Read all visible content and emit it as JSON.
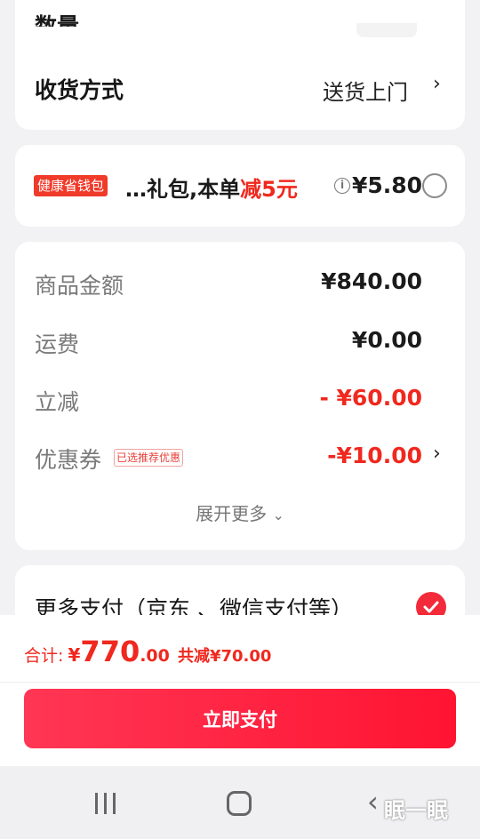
{
  "card1": {
    "qty_label_partial": "数量",
    "delivery_label": "收货方式",
    "delivery_value": "送货上门"
  },
  "card2": {
    "badge": "健康省钱包",
    "promo_text": "…礼包,本单",
    "promo_highlight": "减5元",
    "price": "¥5.80"
  },
  "card3": {
    "rows": [
      {
        "label": "商品金额",
        "value": "¥840.00"
      },
      {
        "label": "运费",
        "value": "¥0.00"
      },
      {
        "label": "立减",
        "value": "- ¥60.00"
      },
      {
        "label": "优惠券",
        "value": "-¥10.00",
        "tag": "已选推荐优惠"
      }
    ],
    "expand_label": "展开更多"
  },
  "card4": {
    "more_payment_label": "更多支付（京东 、微信支付等）"
  },
  "footer": {
    "total_label": "合计:",
    "currency": "¥",
    "total_int": "770",
    "total_dec": ".00",
    "saved_label": "共减¥70.00",
    "pay_button": "立即支付"
  },
  "navbar": {
    "watermark": "眠一眠"
  },
  "colors": {
    "accent_red": "#f0281e",
    "button_gradient_start": "#ff3654",
    "button_gradient_end": "#ff1432"
  }
}
